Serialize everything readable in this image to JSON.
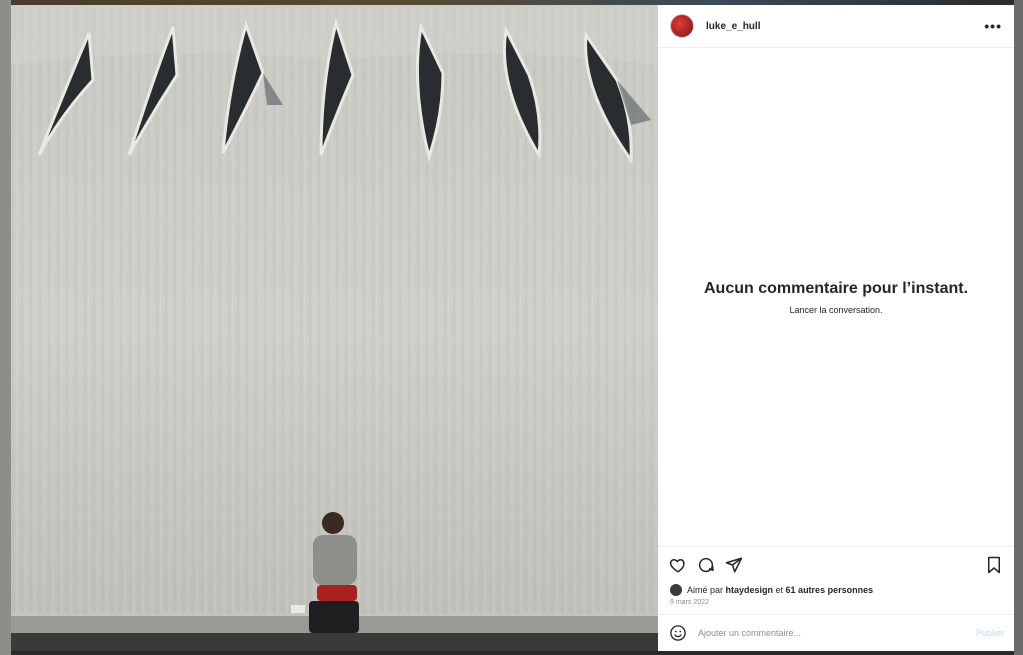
{
  "post": {
    "username": "luke_e_hull",
    "more_icon": "ellipsis-icon",
    "photo_alt": "Concrete building facade with pointed windows and a person seated below"
  },
  "comments": {
    "empty_title": "Aucun commentaire pour l’instant.",
    "empty_subtitle": "Lancer la conversation."
  },
  "actions": {
    "icons": [
      "heart-icon",
      "comment-icon",
      "share-icon",
      "bookmark-icon"
    ]
  },
  "likes": {
    "prefix": "Aimé par ",
    "user": "htaydesign",
    "middle": " et ",
    "others": "61 autres personnes"
  },
  "date": "9 mars 2022",
  "composer": {
    "placeholder": "Ajouter un commentaire...",
    "publish_label": "Publier"
  },
  "colors": {
    "accent_publish": "#b2dffc",
    "text": "#262626",
    "muted": "#8e8e8e"
  }
}
